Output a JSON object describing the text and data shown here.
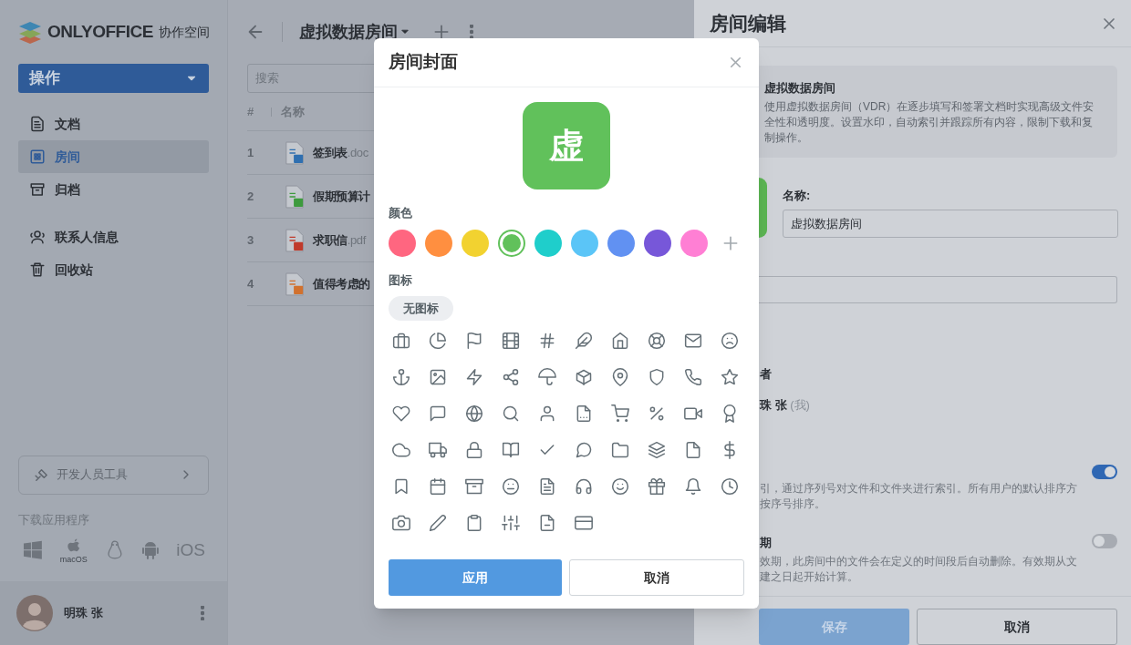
{
  "sidebar": {
    "logo_text": "ONLYOFFICE",
    "logo_subtitle": "协作空间",
    "actions_button": "操作",
    "items": [
      {
        "label": "文档",
        "kind": "documents",
        "selected": false
      },
      {
        "label": "房间",
        "kind": "rooms",
        "selected": true
      },
      {
        "label": "归档",
        "kind": "archive",
        "selected": false
      }
    ],
    "secondary_items": [
      {
        "label": "联系人信息",
        "kind": "contacts",
        "selected": false
      },
      {
        "label": "回收站",
        "kind": "trash",
        "selected": false
      }
    ],
    "developer_tools": "开发人员工具",
    "download_label": "下载应用程序",
    "downloads": [
      {
        "kind": "windows"
      },
      {
        "kind": "macos",
        "label": "macOS"
      },
      {
        "kind": "linux"
      },
      {
        "kind": "android"
      },
      {
        "kind": "ios",
        "label": "iOS"
      }
    ],
    "user_name": "明珠 张"
  },
  "main": {
    "title": "虚拟数据房间",
    "search": {
      "placeholder": "搜索"
    },
    "columns": [
      "#",
      "名称"
    ],
    "rows": [
      {
        "index": "1",
        "name": "签到表",
        "ext": ".doc",
        "kind": "document"
      },
      {
        "index": "2",
        "name": "假期预算计",
        "kind": "spreadsheet"
      },
      {
        "index": "3",
        "name": "求职信",
        "ext": ".pdf",
        "kind": "pdf"
      },
      {
        "index": "4",
        "name": "值得考虑的",
        "kind": "presentation"
      }
    ]
  },
  "room_panel": {
    "title": "房间编辑",
    "type_card": {
      "title": "虚拟数据房间",
      "description": "使用虚拟数据房间（VDR）在逐步填写和签署文档时实现高级文件安全性和透明度。设置水印，自动索引并跟踪所有内容，限制下载和复制操作。"
    },
    "name_label": "名称:",
    "name_value": "虚拟数据房间",
    "owner_heading": "者",
    "owner_name": "珠 张",
    "owner_suffix": "(我)",
    "settings": [
      {
        "lines": [
          "引，通过序列号对文件和文件夹进行索引。所有用户的默认排序方",
          "按序号排序。"
        ],
        "on": true
      },
      {
        "title": "期",
        "lines": [
          "效期，此房间中的文件会在定义的时间段后自动删除。有效期从文",
          "建之日起开始计算。"
        ],
        "on": false
      }
    ],
    "buttons": [
      {
        "label": "保存",
        "kind": "primary",
        "disabled": true
      },
      {
        "label": "取消",
        "kind": "secondary",
        "disabled": false
      }
    ]
  },
  "dialog": {
    "title": "房间封面",
    "cover_letter": "虚",
    "color_label": "颜色",
    "colors": [
      {
        "color": "#ff6680",
        "selected": false
      },
      {
        "color": "#ff8f40",
        "selected": false
      },
      {
        "color": "#f2d230",
        "selected": false
      },
      {
        "color": "#61c15b",
        "selected": true
      },
      {
        "color": "#1fcecb",
        "selected": false
      },
      {
        "color": "#5bc5f7",
        "selected": false
      },
      {
        "color": "#6191f2",
        "selected": false
      },
      {
        "color": "#7757d9",
        "selected": false
      },
      {
        "color": "#ff7fd4",
        "selected": false
      }
    ],
    "icon_label": "图标",
    "no_icon": "无图标",
    "buttons": [
      {
        "label": "应用",
        "kind": "primary"
      },
      {
        "label": "取消",
        "kind": "secondary"
      }
    ]
  }
}
